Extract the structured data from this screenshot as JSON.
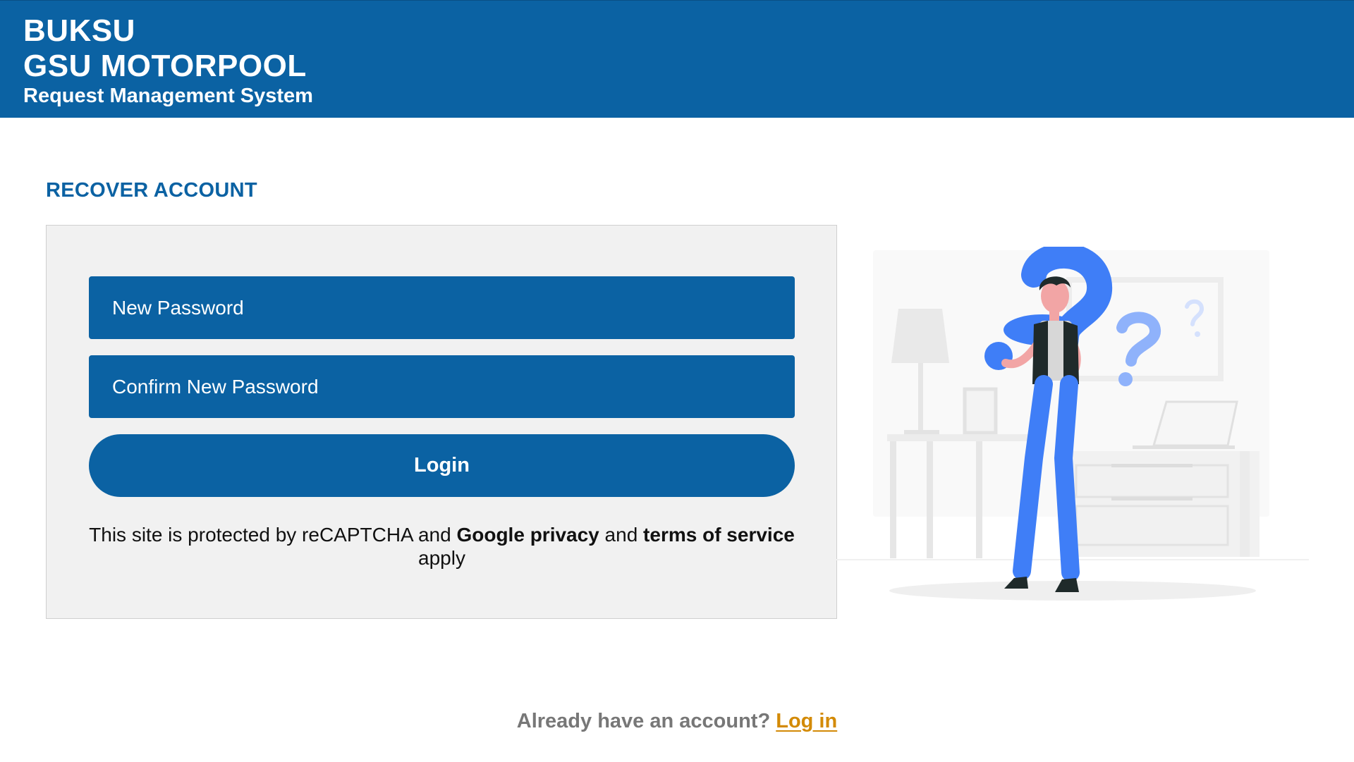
{
  "header": {
    "line1": "BUKSU",
    "line2": "GSU MOTORPOOL",
    "line3": "Request Management System",
    "bg_color": "#0b62a3"
  },
  "section_title": "RECOVER ACCOUNT",
  "form": {
    "new_password_placeholder": "New Password",
    "confirm_password_placeholder": "Confirm New Password",
    "login_label": "Login",
    "recaptcha": {
      "prefix": "This site is protected by reCAPTCHA and ",
      "privacy_link": "Google privacy",
      "middle": " and ",
      "terms_link": "terms of service",
      "suffix": " apply"
    }
  },
  "illustration": {
    "icon": "person-question-marks-illustration"
  },
  "footer": {
    "prompt": "Already have an account? ",
    "login_link": "Log in",
    "link_color": "#d38a06"
  }
}
